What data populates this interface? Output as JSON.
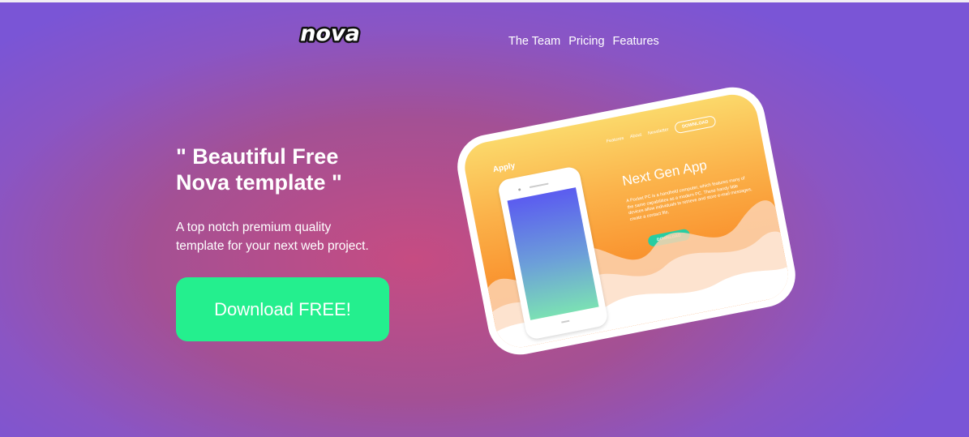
{
  "header": {
    "logo_text": "nova",
    "nav": [
      {
        "label": "The Team"
      },
      {
        "label": "Pricing"
      },
      {
        "label": "Features"
      }
    ]
  },
  "hero": {
    "title": "\" Beautiful Free\nNova template \"",
    "subtitle": "A top notch premium quality\ntemplate for your next web project.",
    "cta_label": "Download FREE!"
  },
  "mockup": {
    "brand": "Apply",
    "nav": [
      "Features",
      "About",
      "Newsletter"
    ],
    "nav_button": "DOWNLOAD",
    "headline": "Next Gen App",
    "description": "A Pocket PC is a handheld computer, which features many of the same capabilities as a modern PC. These handy little devices allow individuals to retrieve and store e-mail messages, create a contact file,",
    "download_button": "DOWNLOAD"
  },
  "colors": {
    "cta": "#24ef8e",
    "background_center": "#c64c82",
    "background_edge": "#7a55d6",
    "mockup_top": "#fbd86a",
    "mockup_bottom": "#f98a30"
  },
  "icons": {
    "logo": "nova-wordmark"
  }
}
